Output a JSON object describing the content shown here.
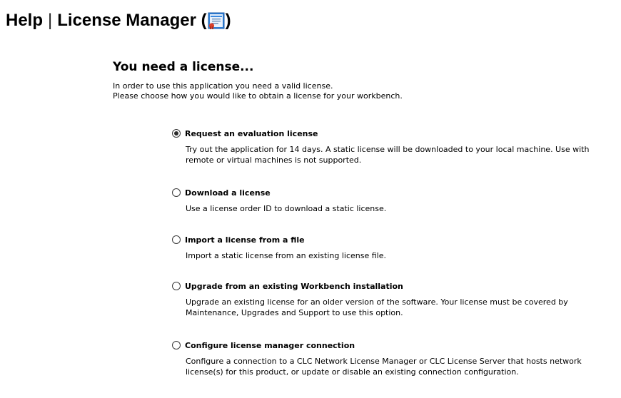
{
  "header": {
    "title_prefix": "Help",
    "separator": "|",
    "title_main": "License Manager (",
    "title_suffix": ")",
    "icon": "license-document-icon"
  },
  "panel": {
    "title": "You need a license...",
    "intro_line1": "In order to use this application you need a valid license.",
    "intro_line2": "Please choose how you would like to obtain a license for your workbench."
  },
  "options": [
    {
      "label": "Request an evaluation license",
      "description": "Try out the application for 14 days. A static license will be downloaded to your local machine. Use with remote or virtual machines is not supported.",
      "selected": true
    },
    {
      "label": "Download a license",
      "description": "Use a license order ID to download a static license.",
      "selected": false
    },
    {
      "label": "Import a license from a file",
      "description": "Import a static license from an existing license file.",
      "selected": false
    },
    {
      "label": "Upgrade from an existing Workbench installation",
      "description": "Upgrade an existing license for an older version of the software. Your license must be covered by Maintenance, Upgrades and Support to use this option.",
      "selected": false
    },
    {
      "label": "Configure license manager connection",
      "description": "Configure a connection to a CLC Network License Manager or CLC License Server that hosts network license(s) for this product, or update or disable an existing connection configuration.",
      "selected": false
    }
  ]
}
